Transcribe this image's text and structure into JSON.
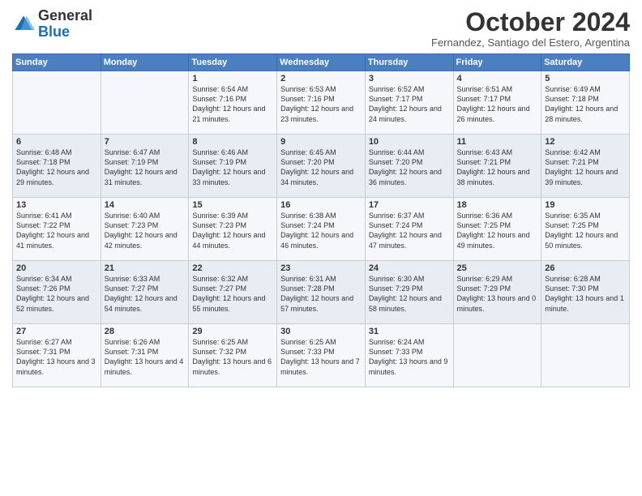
{
  "logo": {
    "general": "General",
    "blue": "Blue"
  },
  "header": {
    "month": "October 2024",
    "location": "Fernandez, Santiago del Estero, Argentina"
  },
  "days_of_week": [
    "Sunday",
    "Monday",
    "Tuesday",
    "Wednesday",
    "Thursday",
    "Friday",
    "Saturday"
  ],
  "weeks": [
    [
      {
        "day": "",
        "sunrise": "",
        "sunset": "",
        "daylight": ""
      },
      {
        "day": "",
        "sunrise": "",
        "sunset": "",
        "daylight": ""
      },
      {
        "day": "1",
        "sunrise": "Sunrise: 6:54 AM",
        "sunset": "Sunset: 7:16 PM",
        "daylight": "Daylight: 12 hours and 21 minutes."
      },
      {
        "day": "2",
        "sunrise": "Sunrise: 6:53 AM",
        "sunset": "Sunset: 7:16 PM",
        "daylight": "Daylight: 12 hours and 23 minutes."
      },
      {
        "day": "3",
        "sunrise": "Sunrise: 6:52 AM",
        "sunset": "Sunset: 7:17 PM",
        "daylight": "Daylight: 12 hours and 24 minutes."
      },
      {
        "day": "4",
        "sunrise": "Sunrise: 6:51 AM",
        "sunset": "Sunset: 7:17 PM",
        "daylight": "Daylight: 12 hours and 26 minutes."
      },
      {
        "day": "5",
        "sunrise": "Sunrise: 6:49 AM",
        "sunset": "Sunset: 7:18 PM",
        "daylight": "Daylight: 12 hours and 28 minutes."
      }
    ],
    [
      {
        "day": "6",
        "sunrise": "Sunrise: 6:48 AM",
        "sunset": "Sunset: 7:18 PM",
        "daylight": "Daylight: 12 hours and 29 minutes."
      },
      {
        "day": "7",
        "sunrise": "Sunrise: 6:47 AM",
        "sunset": "Sunset: 7:19 PM",
        "daylight": "Daylight: 12 hours and 31 minutes."
      },
      {
        "day": "8",
        "sunrise": "Sunrise: 6:46 AM",
        "sunset": "Sunset: 7:19 PM",
        "daylight": "Daylight: 12 hours and 33 minutes."
      },
      {
        "day": "9",
        "sunrise": "Sunrise: 6:45 AM",
        "sunset": "Sunset: 7:20 PM",
        "daylight": "Daylight: 12 hours and 34 minutes."
      },
      {
        "day": "10",
        "sunrise": "Sunrise: 6:44 AM",
        "sunset": "Sunset: 7:20 PM",
        "daylight": "Daylight: 12 hours and 36 minutes."
      },
      {
        "day": "11",
        "sunrise": "Sunrise: 6:43 AM",
        "sunset": "Sunset: 7:21 PM",
        "daylight": "Daylight: 12 hours and 38 minutes."
      },
      {
        "day": "12",
        "sunrise": "Sunrise: 6:42 AM",
        "sunset": "Sunset: 7:21 PM",
        "daylight": "Daylight: 12 hours and 39 minutes."
      }
    ],
    [
      {
        "day": "13",
        "sunrise": "Sunrise: 6:41 AM",
        "sunset": "Sunset: 7:22 PM",
        "daylight": "Daylight: 12 hours and 41 minutes."
      },
      {
        "day": "14",
        "sunrise": "Sunrise: 6:40 AM",
        "sunset": "Sunset: 7:23 PM",
        "daylight": "Daylight: 12 hours and 42 minutes."
      },
      {
        "day": "15",
        "sunrise": "Sunrise: 6:39 AM",
        "sunset": "Sunset: 7:23 PM",
        "daylight": "Daylight: 12 hours and 44 minutes."
      },
      {
        "day": "16",
        "sunrise": "Sunrise: 6:38 AM",
        "sunset": "Sunset: 7:24 PM",
        "daylight": "Daylight: 12 hours and 46 minutes."
      },
      {
        "day": "17",
        "sunrise": "Sunrise: 6:37 AM",
        "sunset": "Sunset: 7:24 PM",
        "daylight": "Daylight: 12 hours and 47 minutes."
      },
      {
        "day": "18",
        "sunrise": "Sunrise: 6:36 AM",
        "sunset": "Sunset: 7:25 PM",
        "daylight": "Daylight: 12 hours and 49 minutes."
      },
      {
        "day": "19",
        "sunrise": "Sunrise: 6:35 AM",
        "sunset": "Sunset: 7:25 PM",
        "daylight": "Daylight: 12 hours and 50 minutes."
      }
    ],
    [
      {
        "day": "20",
        "sunrise": "Sunrise: 6:34 AM",
        "sunset": "Sunset: 7:26 PM",
        "daylight": "Daylight: 12 hours and 52 minutes."
      },
      {
        "day": "21",
        "sunrise": "Sunrise: 6:33 AM",
        "sunset": "Sunset: 7:27 PM",
        "daylight": "Daylight: 12 hours and 54 minutes."
      },
      {
        "day": "22",
        "sunrise": "Sunrise: 6:32 AM",
        "sunset": "Sunset: 7:27 PM",
        "daylight": "Daylight: 12 hours and 55 minutes."
      },
      {
        "day": "23",
        "sunrise": "Sunrise: 6:31 AM",
        "sunset": "Sunset: 7:28 PM",
        "daylight": "Daylight: 12 hours and 57 minutes."
      },
      {
        "day": "24",
        "sunrise": "Sunrise: 6:30 AM",
        "sunset": "Sunset: 7:29 PM",
        "daylight": "Daylight: 12 hours and 58 minutes."
      },
      {
        "day": "25",
        "sunrise": "Sunrise: 6:29 AM",
        "sunset": "Sunset: 7:29 PM",
        "daylight": "Daylight: 13 hours and 0 minutes."
      },
      {
        "day": "26",
        "sunrise": "Sunrise: 6:28 AM",
        "sunset": "Sunset: 7:30 PM",
        "daylight": "Daylight: 13 hours and 1 minute."
      }
    ],
    [
      {
        "day": "27",
        "sunrise": "Sunrise: 6:27 AM",
        "sunset": "Sunset: 7:31 PM",
        "daylight": "Daylight: 13 hours and 3 minutes."
      },
      {
        "day": "28",
        "sunrise": "Sunrise: 6:26 AM",
        "sunset": "Sunset: 7:31 PM",
        "daylight": "Daylight: 13 hours and 4 minutes."
      },
      {
        "day": "29",
        "sunrise": "Sunrise: 6:25 AM",
        "sunset": "Sunset: 7:32 PM",
        "daylight": "Daylight: 13 hours and 6 minutes."
      },
      {
        "day": "30",
        "sunrise": "Sunrise: 6:25 AM",
        "sunset": "Sunset: 7:33 PM",
        "daylight": "Daylight: 13 hours and 7 minutes."
      },
      {
        "day": "31",
        "sunrise": "Sunrise: 6:24 AM",
        "sunset": "Sunset: 7:33 PM",
        "daylight": "Daylight: 13 hours and 9 minutes."
      },
      {
        "day": "",
        "sunrise": "",
        "sunset": "",
        "daylight": ""
      },
      {
        "day": "",
        "sunrise": "",
        "sunset": "",
        "daylight": ""
      }
    ]
  ]
}
